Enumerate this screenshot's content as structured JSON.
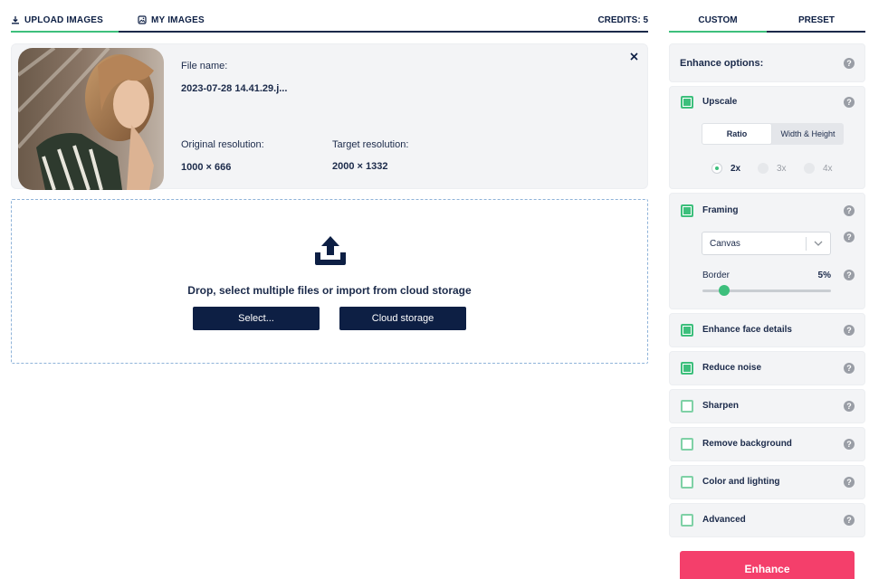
{
  "tabs": {
    "upload": "UPLOAD IMAGES",
    "my_images": "MY IMAGES",
    "credits": "CREDITS: 5"
  },
  "file": {
    "name_label": "File name:",
    "name_value": "2023-07-28 14.41.29.j...",
    "orig_label": "Original resolution:",
    "orig_value": "1000 × 666",
    "target_label": "Target resolution:",
    "target_value": "2000 × 1332"
  },
  "drop": {
    "text": "Drop, select multiple files or import from cloud storage",
    "select_label": "Select...",
    "cloud_label": "Cloud storage"
  },
  "right_tabs": {
    "custom": "CUSTOM",
    "preset": "PRESET"
  },
  "enhance_options": {
    "title": "Enhance options:"
  },
  "upscale": {
    "label": "Upscale",
    "checked": true,
    "mode_ratio": "Ratio",
    "mode_wh": "Width & Height",
    "options": [
      "2x",
      "3x",
      "4x"
    ],
    "selected": "2x"
  },
  "framing": {
    "label": "Framing",
    "checked": true,
    "select_value": "Canvas",
    "border_label": "Border",
    "border_value": "5%",
    "border_fraction": 0.17
  },
  "options": [
    {
      "label": "Enhance face details",
      "checked": true
    },
    {
      "label": "Reduce noise",
      "checked": true
    },
    {
      "label": "Sharpen",
      "checked": false
    },
    {
      "label": "Remove background",
      "checked": false
    },
    {
      "label": "Color and lighting",
      "checked": false
    },
    {
      "label": "Advanced",
      "checked": false
    }
  ],
  "help_glyph": "?",
  "enhance_button": "Enhance",
  "colors": {
    "accent": "#3dbf7c",
    "navy": "#0d1f44",
    "enhance": "#f43f6b"
  },
  "icons": [
    "download-icon",
    "images-icon",
    "close-icon",
    "upload-cloud-icon",
    "help-icon",
    "chevron-down-icon"
  ]
}
